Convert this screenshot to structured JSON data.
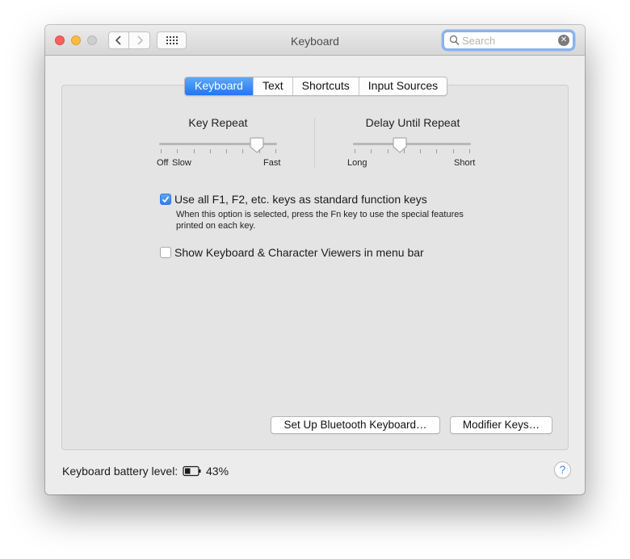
{
  "window": {
    "title": "Keyboard",
    "search_placeholder": "Search"
  },
  "tabs": [
    {
      "label": "Keyboard",
      "active": true
    },
    {
      "label": "Text",
      "active": false
    },
    {
      "label": "Shortcuts",
      "active": false
    },
    {
      "label": "Input Sources",
      "active": false
    }
  ],
  "key_repeat": {
    "title": "Key Repeat",
    "min_label": "Off",
    "slow_label": "Slow",
    "max_label": "Fast",
    "level": 0.83
  },
  "delay_until_repeat": {
    "title": "Delay Until Repeat",
    "min_label": "Long",
    "max_label": "Short",
    "level": 0.4
  },
  "options": {
    "function_keys": {
      "label": "Use all F1, F2, etc. keys as standard function keys",
      "description": "When this option is selected, press the Fn key to use the special features printed on each key.",
      "checked": true
    },
    "show_viewers": {
      "label": "Show Keyboard & Character Viewers in menu bar",
      "checked": false
    }
  },
  "buttons": {
    "bluetooth": "Set Up Bluetooth Keyboard…",
    "modifier": "Modifier Keys…"
  },
  "battery": {
    "label": "Keyboard battery level:",
    "percent_text": "43%",
    "level": 0.43
  },
  "help": "?",
  "colors": {
    "accent": "#2f7ef0",
    "close": "#fc605c",
    "minimize": "#fdbc40"
  }
}
